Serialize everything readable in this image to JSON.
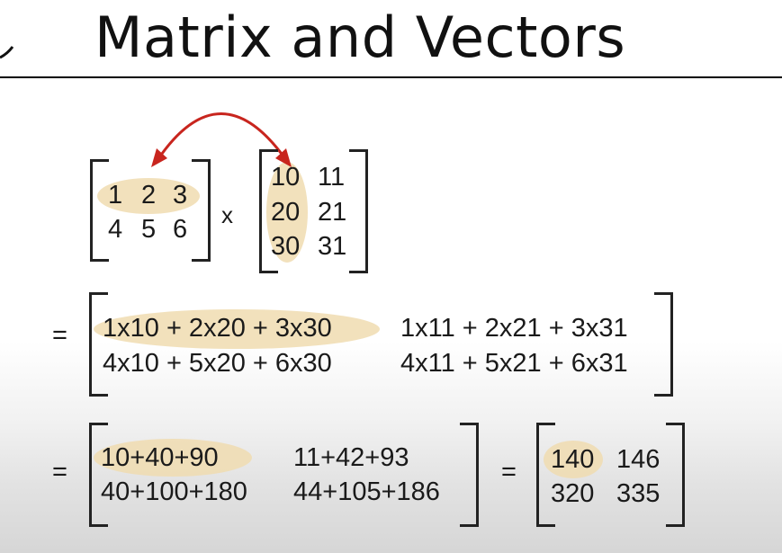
{
  "slide": {
    "title": "Matrix and Vectors"
  },
  "matrix_a": {
    "rows": [
      [
        "1",
        "2",
        "3"
      ],
      [
        "4",
        "5",
        "6"
      ]
    ]
  },
  "multiply_sign": "x",
  "matrix_b": {
    "rows": [
      [
        "10",
        "11"
      ],
      [
        "20",
        "21"
      ],
      [
        "30",
        "31"
      ]
    ]
  },
  "step1": {
    "equals": "=",
    "rows": [
      [
        "1x10 + 2x20 + 3x30",
        "1x11 + 2x21 + 3x31"
      ],
      [
        "4x10 + 5x20 + 6x30",
        "4x11 + 5x21 + 6x31"
      ]
    ]
  },
  "step2": {
    "equals": "=",
    "rows": [
      [
        "10+40+90",
        "11+42+93"
      ],
      [
        "40+100+180",
        "44+105+186"
      ]
    ]
  },
  "result": {
    "equals": "=",
    "rows": [
      [
        "140",
        "146"
      ],
      [
        "320",
        "335"
      ]
    ]
  },
  "colors": {
    "highlight": "#f0dcb0",
    "arrow": "#c8251e"
  }
}
